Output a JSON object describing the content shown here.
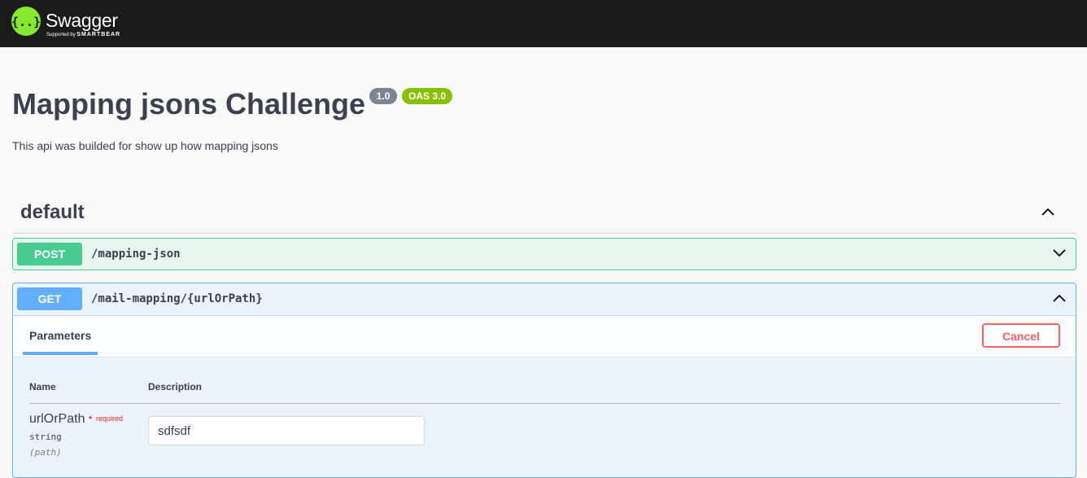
{
  "header": {
    "logo_text": "Swagger",
    "logo_sub_prefix": "Supported by",
    "logo_sub_brand": "SMARTBEAR",
    "logo_icon": "swagger-braces-icon"
  },
  "info": {
    "title": "Mapping jsons Challenge",
    "version_badge": "1.0",
    "oas_badge": "OAS 3.0",
    "description": "This api was builded for show up how mapping jsons"
  },
  "section": {
    "title": "default",
    "collapse_icon": "chevron-up-icon"
  },
  "operations": [
    {
      "method": "POST",
      "path": "/mapping-json",
      "expanded": false,
      "color": "#49cc90"
    },
    {
      "method": "GET",
      "path": "/mail-mapping/{urlOrPath}",
      "expanded": true,
      "color": "#61affe",
      "tab_label": "Parameters",
      "cancel_label": "Cancel",
      "columns": {
        "name": "Name",
        "description": "Description"
      },
      "parameter": {
        "name": "urlOrPath",
        "required_star": "*",
        "required_label": "required",
        "type": "string",
        "location": "(path)",
        "value": "sdfsdf"
      }
    }
  ],
  "colors": {
    "topbar": "#1b1b1b",
    "logo_green": "#85ea2d",
    "badge_grey": "#7d8492",
    "badge_green": "#89bf04",
    "cancel_red": "#ff6060"
  }
}
